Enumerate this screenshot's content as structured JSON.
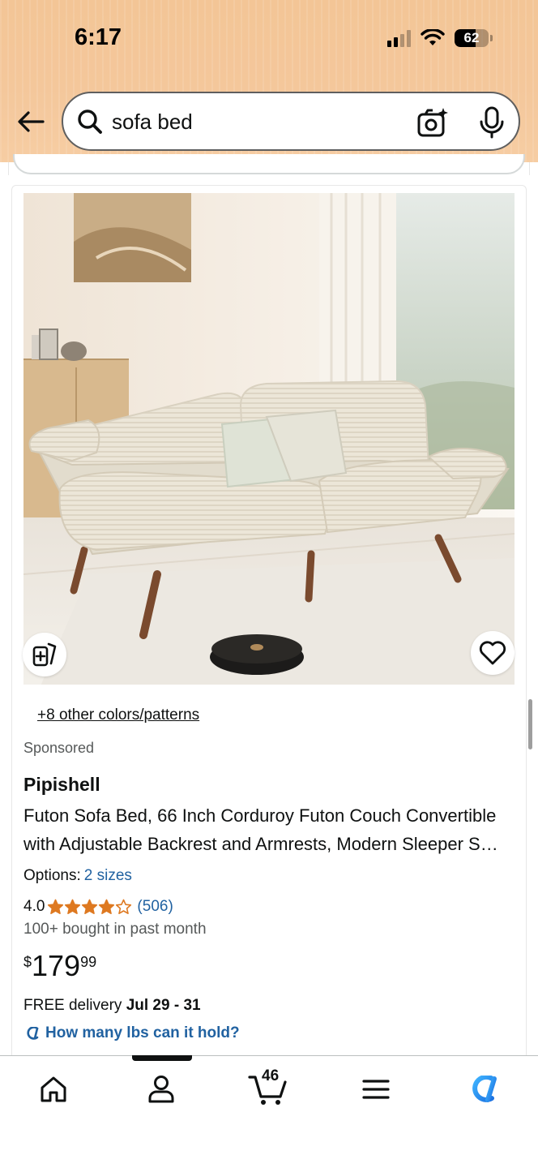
{
  "status_bar": {
    "time": "6:17",
    "battery": "62",
    "battery_level": 0.62
  },
  "search": {
    "query": "sofa bed"
  },
  "product": {
    "image_alt": "Futon sofa bed in cream corduroy in a living room",
    "colors_link": "+8 other colors/patterns",
    "sponsored": "Sponsored",
    "brand": "Pipishell",
    "title": "Futon Sofa Bed, 66 Inch Corduroy Futon Couch Convertible with Adjustable Backrest and Armrests, Modern Sleeper Sofa for Living Room",
    "options_label": "Options:",
    "options_value": "2 sizes",
    "rating": "4.0",
    "rating_value": 4.0,
    "review_count": "(506)",
    "bought": "100+ bought in past month",
    "price_symbol": "$",
    "price_whole": "179",
    "price_fraction": "99",
    "delivery_prefix": "FREE delivery",
    "delivery_dates": "Jul 29 - 31",
    "ask_question": "How many lbs can it hold?"
  },
  "bottom_nav": {
    "cart_count": "46"
  },
  "colors": {
    "header_bg": "#f3c596",
    "link_blue": "#2162a1",
    "star_orange": "#de7921",
    "alexa_blue": "#1a98ff"
  }
}
